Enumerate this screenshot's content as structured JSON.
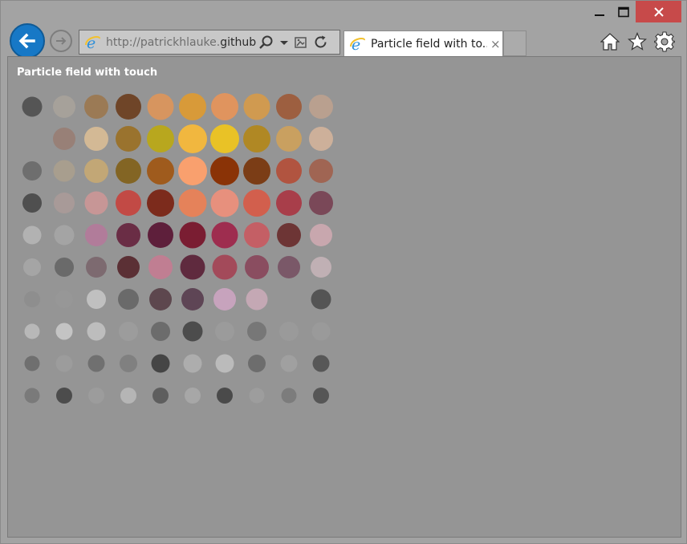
{
  "browser": {
    "address": {
      "prefix": "http://patrickhlauke.",
      "host": "github"
    },
    "tab": {
      "title": "Particle field with to...",
      "close": "×"
    },
    "icons": [
      "back-arrow-icon",
      "forward-arrow-icon",
      "ie-logo-icon",
      "search-icon",
      "dropdown-icon",
      "compat-view-icon",
      "refresh-icon",
      "home-icon",
      "favorites-star-icon",
      "settings-gear-icon"
    ]
  },
  "page": {
    "title": "Particle field with touch"
  },
  "particles": {
    "rows": [
      [
        "#555555",
        "#a6a19a",
        "#9b7a55",
        "#6f4528",
        "#d7955f",
        "#d89a39",
        "#e0945e",
        "#d09a50",
        "#9d5f40",
        "#b9a08f"
      ],
      [
        null,
        "#988077",
        "#d3b995",
        "#9a732e",
        "#b8a71e",
        "#f1b73f",
        "#e9c226",
        "#b08824",
        "#c9a060",
        "#cdb09a"
      ],
      [
        "#6e6e6e",
        "#a89e8e",
        "#c2a776",
        "#836524",
        "#9f5b1d",
        "#f9a06e",
        "#8a3306",
        "#7b3d16",
        "#b15440",
        "#a06553"
      ],
      [
        "#4f4f4f",
        "#a89a98",
        "#c79696",
        "#c24a45",
        "#7c2b1c",
        "#e5825a",
        "#e7907d",
        "#d25f4d",
        "#a83e4a",
        "#7a4858"
      ],
      [
        "#b2b2b2",
        "#a4a4a4",
        "#b17c9a",
        "#6a2d45",
        "#5e1f3b",
        "#7a1d32",
        "#9e2d4f",
        "#c45f65",
        "#6d3535",
        "#c8a7ae"
      ],
      [
        "#a5a5a5",
        "#6a6a6a",
        "#7d6a70",
        "#5b3035",
        "#c07e92",
        "#5f2a3e",
        "#a34a5a",
        "#8a4d60",
        "#7a5868",
        "#c0b0b4"
      ],
      [
        "#8e8e8e",
        "#979797",
        "#c0c0c0",
        "#6a6a6a",
        "#5d474e",
        "#5e4555",
        "#c7a3bd",
        "#c4a8b4",
        null,
        "#545454"
      ],
      [
        "#b8b8b8",
        "#c4c4c4",
        "#bdbdbd",
        "#9c9c9c",
        "#6c6c6c",
        "#4c4c4c",
        "#9b9b9b",
        "#777777",
        "#9a9a9a",
        "#9a9a9a"
      ],
      [
        "#6f6f6f",
        "#9c9c9c",
        "#707070",
        "#808080",
        "#454545",
        "#adadad",
        "#bbbbbb",
        "#6d6d6d",
        "#a0a0a0",
        "#575757"
      ],
      [
        "#7a7a7a",
        "#4c4c4c",
        "#9c9c9c",
        "#b5b5b5",
        "#5e5e5e",
        "#a7a7a7",
        "#4a4a4a",
        "#9d9d9d",
        "#7c7c7c",
        "#565656"
      ]
    ],
    "radii": [
      [
        12.5,
        14,
        15,
        16,
        16.5,
        17,
        17,
        16.5,
        16,
        15
      ],
      [
        0,
        14,
        15,
        16,
        17,
        18,
        18,
        17,
        16,
        15
      ],
      [
        12,
        13.5,
        15,
        16,
        17,
        18,
        18,
        17,
        16,
        15
      ],
      [
        12,
        13,
        14.5,
        16,
        17,
        17.5,
        17.5,
        17,
        16,
        15
      ],
      [
        11.5,
        12.5,
        14,
        15,
        16,
        16.5,
        16.5,
        16,
        15,
        14
      ],
      [
        11,
        12,
        13,
        14,
        15,
        15.5,
        15.5,
        15,
        14,
        13
      ],
      [
        10,
        11,
        12,
        13,
        14,
        14,
        14,
        13.5,
        0,
        12.5
      ],
      [
        9.5,
        10.5,
        11.5,
        12,
        12,
        12.5,
        12,
        12,
        12,
        11.5
      ],
      [
        9.5,
        10.5,
        10.5,
        11,
        11.5,
        11.5,
        11.5,
        11,
        10.5,
        10.5
      ],
      [
        9.5,
        10,
        10,
        10,
        10,
        10,
        10,
        9.5,
        9.5,
        10
      ]
    ]
  }
}
